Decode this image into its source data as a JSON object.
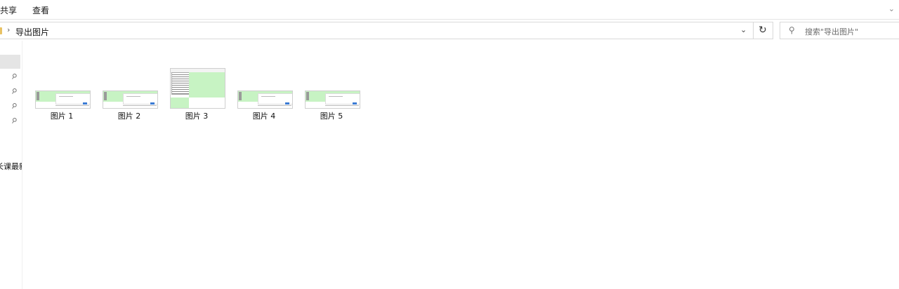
{
  "ribbon": {
    "tabs": [
      "共享",
      "查看"
    ]
  },
  "address": {
    "crumbs": [
      "导出图片"
    ]
  },
  "search": {
    "placeholder": "搜索\"导出图片\""
  },
  "nav": {
    "cut_label": "长课最新"
  },
  "files": [
    {
      "name": "图片 1"
    },
    {
      "name": "图片 2"
    },
    {
      "name": "图片 3"
    },
    {
      "name": "图片 4"
    },
    {
      "name": "图片 5"
    }
  ],
  "icons": {
    "chevron": "chevron-down-icon",
    "refresh": "refresh-icon",
    "search": "search-icon",
    "pin": "pin-icon",
    "folder": "folder-icon"
  },
  "colors": {
    "thumb_green": "#c7f3c3",
    "selection": "#e5e5e5"
  }
}
